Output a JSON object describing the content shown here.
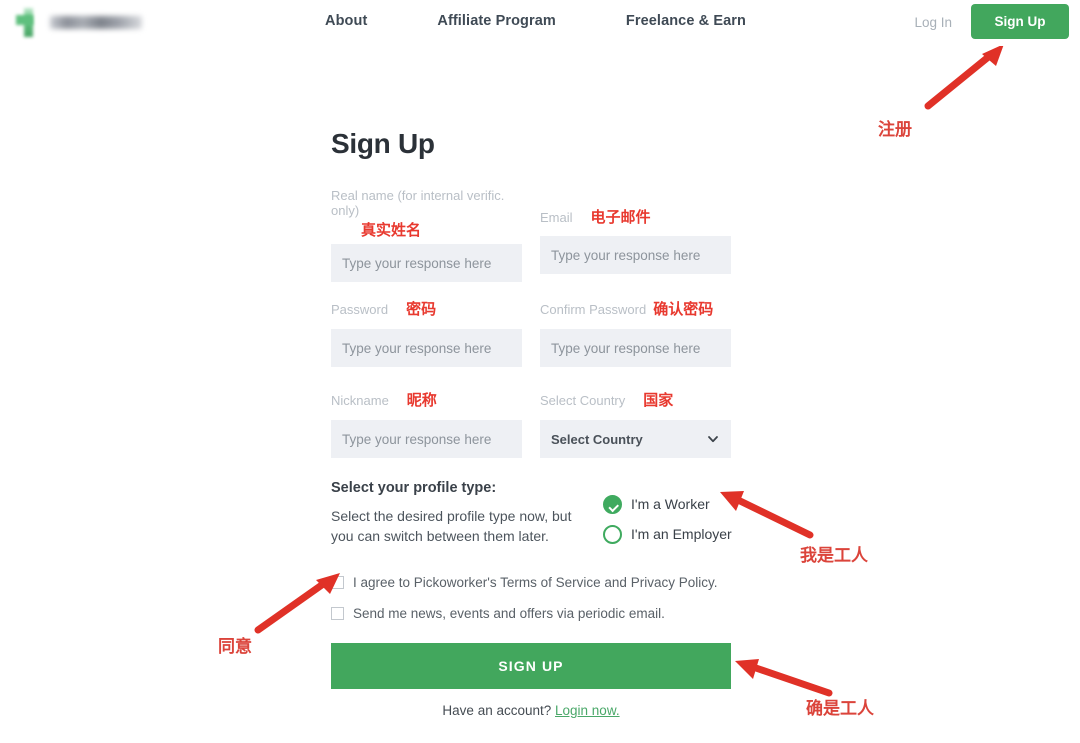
{
  "header": {
    "logo_name": "pickoworker-logo",
    "nav": [
      {
        "label": "About"
      },
      {
        "label": "Affiliate Program"
      },
      {
        "label": "Freelance & Earn"
      }
    ],
    "login_label": "Log In",
    "signup_label": "Sign Up"
  },
  "form": {
    "title": "Sign Up",
    "placeholder": "Type your response here",
    "fields": {
      "real_name": {
        "label": "Real name (for internal verific. only)",
        "cn": "真实姓名",
        "value": "",
        "placeholder": "Type your response here"
      },
      "email": {
        "label": "Email",
        "cn": "电子邮件",
        "value": "",
        "placeholder": "Type your response here"
      },
      "password": {
        "label": "Password",
        "cn": "密码",
        "value": "",
        "placeholder": "Type your response here"
      },
      "confirm_password": {
        "label": "Confirm Password",
        "cn": "确认密码",
        "value": "",
        "placeholder": "Type your response here"
      },
      "nickname": {
        "label": "Nickname",
        "cn": "昵称",
        "value": "",
        "placeholder": "Type your response here"
      },
      "country": {
        "label": "Select Country",
        "cn": "国家",
        "selected": "Select Country",
        "icon": "chevron-down-icon"
      }
    }
  },
  "profile": {
    "heading": "Select your profile type:",
    "description": "Select the desired profile type now, but you can switch between them later.",
    "options": [
      {
        "label": "I'm a Worker",
        "selected": true
      },
      {
        "label": "I'm an Employer",
        "selected": false
      }
    ]
  },
  "consents": [
    {
      "label": "I agree to Pickoworker's Terms of Service and Privacy Policy.",
      "checked": false
    },
    {
      "label": "Send me news, events and offers via periodic email.",
      "checked": false
    }
  ],
  "submit": {
    "label": "SIGN UP"
  },
  "footer": {
    "have_account": "Have an account?",
    "login_link": "Login now."
  },
  "annotations": [
    {
      "text": "注册",
      "target": "signup-button-top"
    },
    {
      "text": "我是工人",
      "target": "worker-radio"
    },
    {
      "text": "同意",
      "target": "terms-checkbox"
    },
    {
      "text": "确是工人",
      "target": "signup-submit"
    }
  ],
  "colors": {
    "brand_green": "#42a75d",
    "annotation_red": "#d9352b",
    "input_bg": "#eef0f4",
    "label_gray": "#b9bfc6"
  }
}
